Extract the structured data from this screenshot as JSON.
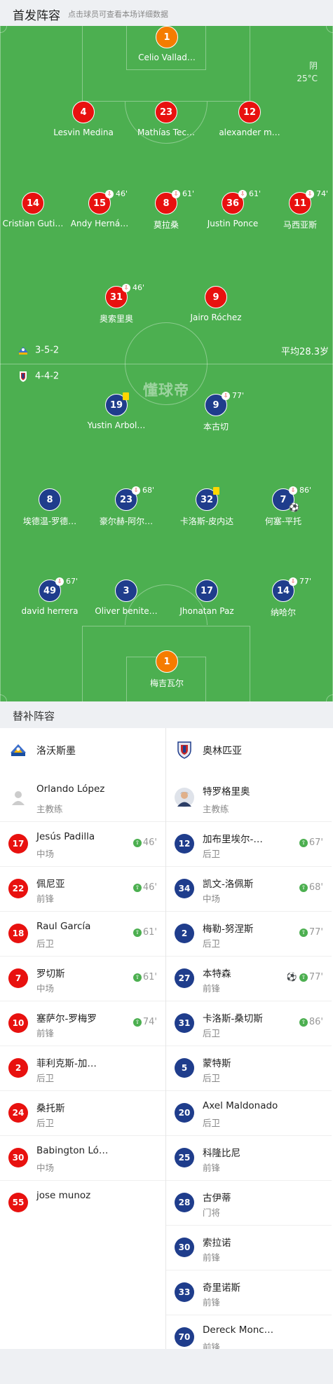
{
  "header": {
    "title": "首发阵容",
    "hint": "点击球员可查看本场详细数据"
  },
  "weather": {
    "condition": "阴",
    "temp": "25°C"
  },
  "logo_text": "懂球帝",
  "home_formation": "3-5-2",
  "away_formation": "4-4-2",
  "avg_age": "平均28.3岁",
  "colors": {
    "home": "#e8110f",
    "away": "#1f3d8c",
    "keeper": "#f57c00",
    "pitch": "#4caf50"
  },
  "lineup": {
    "home": [
      {
        "number": "1",
        "name": "Celio Vallad…",
        "kit": "gk"
      },
      {
        "number": "4",
        "name": "Lesvin Medina",
        "kit": "red"
      },
      {
        "number": "23",
        "name": "Mathías Tec…",
        "kit": "red"
      },
      {
        "number": "12",
        "name": "alexander m…",
        "kit": "red"
      },
      {
        "number": "14",
        "name": "Cristian Guti…",
        "kit": "red"
      },
      {
        "number": "15",
        "name": "Andy Herná…",
        "kit": "red",
        "sub_minute": "46'"
      },
      {
        "number": "8",
        "name": "莫拉桑",
        "kit": "red",
        "sub_minute": "61'"
      },
      {
        "number": "36",
        "name": "Justin Ponce",
        "kit": "red",
        "sub_minute": "61'"
      },
      {
        "number": "11",
        "name": "马西亚斯",
        "kit": "red",
        "sub_minute": "74'"
      },
      {
        "number": "31",
        "name": "奥索里奥",
        "kit": "red",
        "sub_minute": "46'"
      },
      {
        "number": "9",
        "name": "Jairo Róchez",
        "kit": "red"
      }
    ],
    "away": [
      {
        "number": "19",
        "name": "Yustin Arbol…",
        "kit": "blue",
        "yellow_card": true
      },
      {
        "number": "9",
        "name": "本古切",
        "kit": "blue",
        "sub_minute": "77'"
      },
      {
        "number": "8",
        "name": "埃德温-罗德…",
        "kit": "blue"
      },
      {
        "number": "23",
        "name": "豪尔赫-阿尔…",
        "kit": "blue",
        "sub_minute": "68'"
      },
      {
        "number": "32",
        "name": "卡洛斯-皮内达",
        "kit": "blue",
        "yellow_card": true
      },
      {
        "number": "7",
        "name": "何塞-平托",
        "kit": "blue",
        "sub_minute": "86'",
        "goal": true
      },
      {
        "number": "49",
        "name": "david herrera",
        "kit": "blue",
        "sub_minute": "67'"
      },
      {
        "number": "3",
        "name": "Oliver benite…",
        "kit": "blue"
      },
      {
        "number": "17",
        "name": "Jhonatan Paz",
        "kit": "blue"
      },
      {
        "number": "14",
        "name": "纳哈尔",
        "kit": "blue",
        "sub_minute": "77'"
      },
      {
        "number": "1",
        "name": "梅吉瓦尔",
        "kit": "gk"
      }
    ]
  },
  "substitutes": {
    "title": "替补阵容",
    "home": {
      "team": "洛沃斯墨",
      "coach": {
        "name": "Orlando López",
        "role": "主教练"
      },
      "players": [
        {
          "number": "17",
          "name": "Jesús Padilla",
          "pos": "中场",
          "minute": "46'"
        },
        {
          "number": "22",
          "name": "佩尼亚",
          "pos": "前锋",
          "minute": "46'"
        },
        {
          "number": "18",
          "name": "Raul García",
          "pos": "后卫",
          "minute": "61'"
        },
        {
          "number": "7",
          "name": "罗切斯",
          "pos": "中场",
          "minute": "61'"
        },
        {
          "number": "10",
          "name": "塞萨尔-罗梅罗",
          "pos": "前锋",
          "minute": "74'"
        },
        {
          "number": "2",
          "name": "菲利克斯-加…",
          "pos": "后卫"
        },
        {
          "number": "24",
          "name": "桑托斯",
          "pos": "后卫"
        },
        {
          "number": "30",
          "name": "Babington Ló…",
          "pos": "中场"
        },
        {
          "number": "55",
          "name": "jose munoz",
          "pos": ""
        }
      ]
    },
    "away": {
      "team": "奥林匹亚",
      "coach": {
        "name": "特罗格里奥",
        "role": "主教练"
      },
      "players": [
        {
          "number": "12",
          "name": "加布里埃尔-…",
          "pos": "后卫",
          "minute": "67'"
        },
        {
          "number": "34",
          "name": "凯文-洛佩斯",
          "pos": "中场",
          "minute": "68'"
        },
        {
          "number": "2",
          "name": "梅勒-努涅斯",
          "pos": "后卫",
          "minute": "77'"
        },
        {
          "number": "27",
          "name": "本特森",
          "pos": "前锋",
          "minute": "77'",
          "goal": true
        },
        {
          "number": "31",
          "name": "卡洛斯-桑切斯",
          "pos": "后卫",
          "minute": "86'"
        },
        {
          "number": "5",
          "name": "蒙特斯",
          "pos": "后卫"
        },
        {
          "number": "20",
          "name": "Axel Maldonado",
          "pos": "后卫"
        },
        {
          "number": "25",
          "name": "科隆比尼",
          "pos": "前锋"
        },
        {
          "number": "28",
          "name": "古伊蒂",
          "pos": "门将"
        },
        {
          "number": "30",
          "name": "索拉诺",
          "pos": "前锋"
        },
        {
          "number": "33",
          "name": "奇里诺斯",
          "pos": "前锋"
        },
        {
          "number": "70",
          "name": "Dereck Monc…",
          "pos": "前锋"
        }
      ]
    }
  }
}
